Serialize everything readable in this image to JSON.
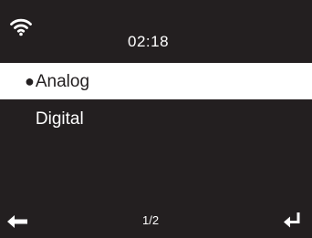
{
  "status_bar": {
    "time": "02:18",
    "wifi_icon": "wifi-icon"
  },
  "menu": {
    "items": [
      {
        "label": "Analog",
        "marker": "●",
        "selected": true
      },
      {
        "label": "Digital",
        "marker": "●",
        "selected": false
      }
    ]
  },
  "footer": {
    "page_indicator": "1/2",
    "back_icon": "arrow-left-icon",
    "enter_icon": "enter-return-icon"
  },
  "colors": {
    "background": "#231f20",
    "text": "#ffffff",
    "highlight_background": "#ffffff",
    "highlight_text": "#231f20"
  }
}
